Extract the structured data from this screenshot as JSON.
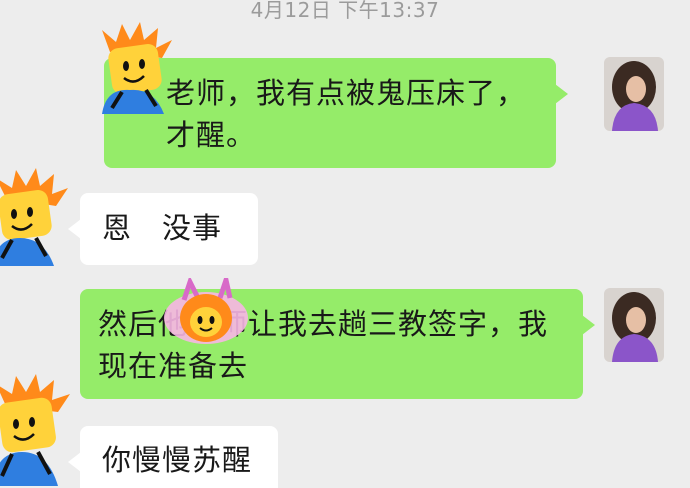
{
  "chat": {
    "timestamp": "4月12日 下午13:37",
    "messages": [
      {
        "sender": "me",
        "text": "老师，我有点被鬼压床了，才醒。"
      },
      {
        "sender": "other",
        "text": "恩　没事"
      },
      {
        "sender": "me",
        "text": "然后他老师让我去趟三教签字，我现在准备去"
      },
      {
        "sender": "other",
        "text": "你慢慢苏醒"
      }
    ]
  },
  "colors": {
    "background": "#ededed",
    "mine_bubble": "#95ec69",
    "theirs_bubble": "#ffffff",
    "timestamp": "#9b9b9b"
  },
  "icons": {
    "my_avatar": "photo-avatar-icon",
    "cover_sticker": "cartoon-face-sticker-icon",
    "other_avatar": "cartoon-face-sticker-icon"
  }
}
